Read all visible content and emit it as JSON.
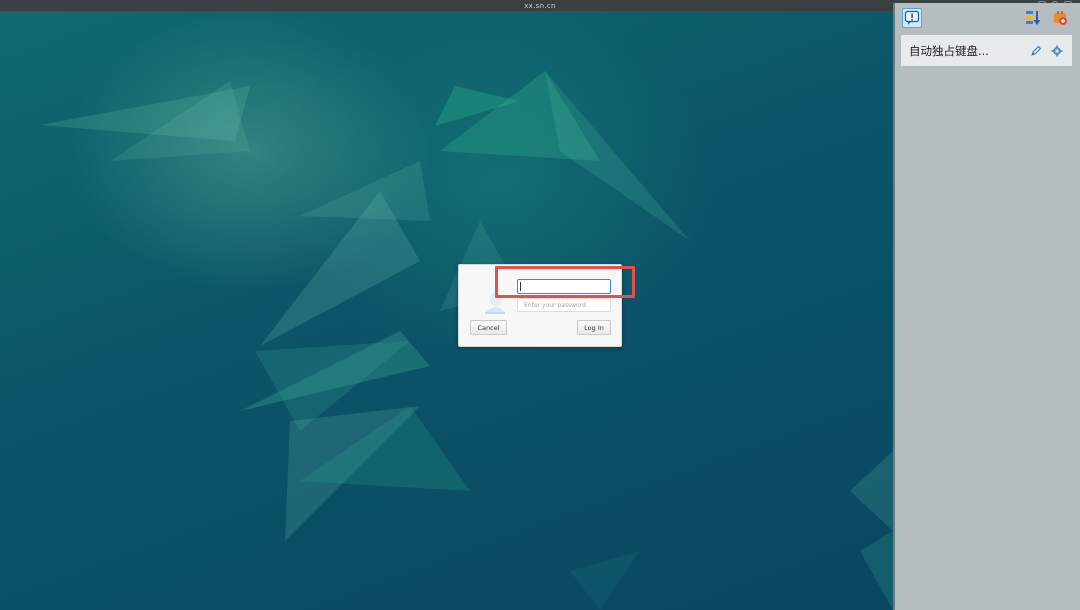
{
  "window": {
    "title": "xx.sn.cn"
  },
  "login_dialog": {
    "username_value": "",
    "password_placeholder": "Enter your password",
    "cancel_label": "Cancel",
    "login_label": "Log In"
  },
  "side_panel": {
    "toolbar": {
      "notice_icon": "exclamation-bubble-icon",
      "sort_icon": "sort-down-icon",
      "plugin_icon": "plugin-icon"
    },
    "items": [
      {
        "label": "自动独占键盘...",
        "edit_icon": "pencil-icon",
        "settings_icon": "gear-icon"
      }
    ]
  },
  "colors": {
    "highlight": "#e0524f",
    "wallpaper": "#0b4a5f",
    "panel": "#b6bdc0",
    "focus": "#3b8bd0"
  }
}
